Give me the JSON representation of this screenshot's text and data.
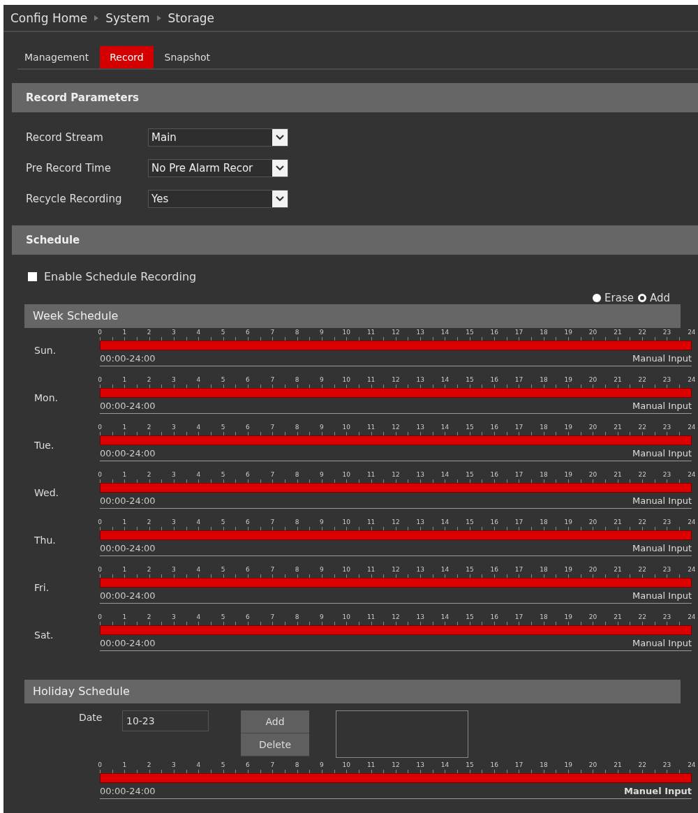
{
  "breadcrumb": [
    "Config Home",
    "System",
    "Storage"
  ],
  "tabs": [
    {
      "label": "Management",
      "selected": false
    },
    {
      "label": "Record",
      "selected": true
    },
    {
      "label": "Snapshot",
      "selected": false
    }
  ],
  "record_parameters": {
    "title": "Record Parameters",
    "fields": [
      {
        "label": "Record Stream",
        "value": "Main"
      },
      {
        "label": "Pre Record Time",
        "value": "No Pre Alarm Recor"
      },
      {
        "label": "Recycle Recording",
        "value": "Yes"
      }
    ]
  },
  "schedule": {
    "title": "Schedule",
    "enable": {
      "label": "Enable Schedule Recording",
      "checked": false
    },
    "modes": [
      {
        "label": "Erase",
        "selected": false
      },
      {
        "label": "Add",
        "selected": true
      }
    ],
    "week": {
      "title": "Week Schedule",
      "days": [
        {
          "day": "Sun.",
          "hours": [
            "0",
            "1",
            "2",
            "3",
            "4",
            "5",
            "6",
            "7",
            "8",
            "9",
            "10",
            "11",
            "12",
            "13",
            "14",
            "15",
            "16",
            "17",
            "18",
            "19",
            "20",
            "21",
            "22",
            "23",
            "24"
          ],
          "range": "00:00-24:00",
          "input_link": "Manual Input"
        },
        {
          "day": "Mon.",
          "hours": [
            "0",
            "1",
            "2",
            "3",
            "4",
            "5",
            "6",
            "7",
            "8",
            "9",
            "10",
            "11",
            "12",
            "13",
            "14",
            "15",
            "16",
            "17",
            "18",
            "19",
            "20",
            "21",
            "22",
            "23",
            "24"
          ],
          "range": "00:00-24:00",
          "input_link": "Manual Input"
        },
        {
          "day": "Tue.",
          "hours": [
            "0",
            "1",
            "2",
            "3",
            "4",
            "5",
            "6",
            "7",
            "8",
            "9",
            "10",
            "11",
            "12",
            "13",
            "14",
            "15",
            "16",
            "17",
            "18",
            "19",
            "20",
            "21",
            "22",
            "23",
            "24"
          ],
          "range": "00:00-24:00",
          "input_link": "Manual Input"
        },
        {
          "day": "Wed.",
          "hours": [
            "0",
            "1",
            "2",
            "3",
            "4",
            "5",
            "6",
            "7",
            "8",
            "9",
            "10",
            "11",
            "12",
            "13",
            "14",
            "15",
            "16",
            "17",
            "18",
            "19",
            "20",
            "21",
            "22",
            "23",
            "24"
          ],
          "range": "00:00-24:00",
          "input_link": "Manual Input"
        },
        {
          "day": "Thu.",
          "hours": [
            "0",
            "1",
            "2",
            "3",
            "4",
            "5",
            "6",
            "7",
            "8",
            "9",
            "10",
            "11",
            "12",
            "13",
            "14",
            "15",
            "16",
            "17",
            "18",
            "19",
            "20",
            "21",
            "22",
            "23",
            "24"
          ],
          "range": "00:00-24:00",
          "input_link": "Manual Input"
        },
        {
          "day": "Fri.",
          "hours": [
            "0",
            "1",
            "2",
            "3",
            "4",
            "5",
            "6",
            "7",
            "8",
            "9",
            "10",
            "11",
            "12",
            "13",
            "14",
            "15",
            "16",
            "17",
            "18",
            "19",
            "20",
            "21",
            "22",
            "23",
            "24"
          ],
          "range": "00:00-24:00",
          "input_link": "Manual Input"
        },
        {
          "day": "Sat.",
          "hours": [
            "0",
            "1",
            "2",
            "3",
            "4",
            "5",
            "6",
            "7",
            "8",
            "9",
            "10",
            "11",
            "12",
            "13",
            "14",
            "15",
            "16",
            "17",
            "18",
            "19",
            "20",
            "21",
            "22",
            "23",
            "24"
          ],
          "range": "00:00-24:00",
          "input_link": "Manual Input"
        }
      ]
    },
    "holiday": {
      "title": "Holiday Schedule",
      "date_label": "Date",
      "date_value": "10-23",
      "buttons": [
        "Add",
        "Delete"
      ],
      "timeline": {
        "hours": [
          "0",
          "1",
          "2",
          "3",
          "4",
          "5",
          "6",
          "7",
          "8",
          "9",
          "10",
          "11",
          "12",
          "13",
          "14",
          "15",
          "16",
          "17",
          "18",
          "19",
          "20",
          "21",
          "22",
          "23",
          "24"
        ],
        "range": "00:00-24:00",
        "input_link": "Manuel Input"
      }
    }
  }
}
